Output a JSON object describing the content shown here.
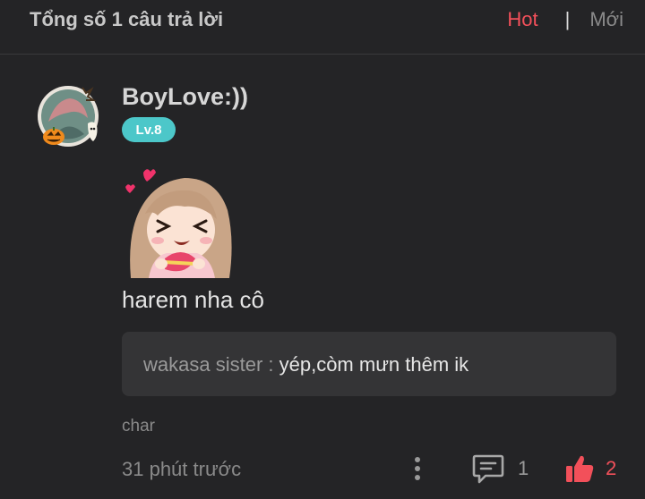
{
  "header": {
    "total_label": "Tổng số 1 câu trả lời",
    "sort_hot": "Hot",
    "sort_separator": "|",
    "sort_new": "Mới",
    "active_sort": "Hot"
  },
  "answer": {
    "username": "BoyLove:))",
    "level_badge": "Lv.8",
    "avatar_icon": "halloween-avatar-icon",
    "sticker_icon": "anime-girl-sticker-icon",
    "text": "harem nha cô",
    "quote": {
      "author": "wakasa sister : ",
      "body": "yép,còm mưn thêm ik"
    },
    "tag": "char",
    "time": "31 phút trước",
    "reply_count": "1",
    "like_count": "2"
  },
  "colors": {
    "background": "#242426",
    "accent": "#f2505a",
    "level_badge": "#4cc7c9",
    "quote_bg": "#343436"
  }
}
